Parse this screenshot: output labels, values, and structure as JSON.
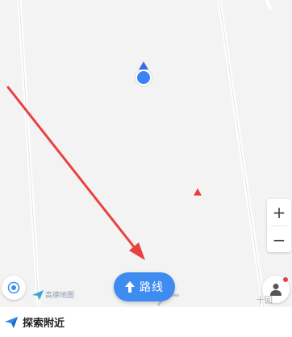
{
  "map": {
    "logo_text": "高德地图",
    "scale_text": "十回"
  },
  "controls": {
    "zoom_in_label": "+",
    "zoom_out_label": "−",
    "route_label": "路线"
  },
  "bottom": {
    "explore_label": "探索附近"
  },
  "colors": {
    "accent": "#3f8cf0",
    "location": "#3b82f6",
    "marker": "#e84040",
    "annotation_arrow": "#e8413f"
  },
  "icons": {
    "locate": "locate-icon",
    "route": "up-arrow-icon",
    "avatar": "user-icon",
    "explore": "paper-plane-icon"
  }
}
